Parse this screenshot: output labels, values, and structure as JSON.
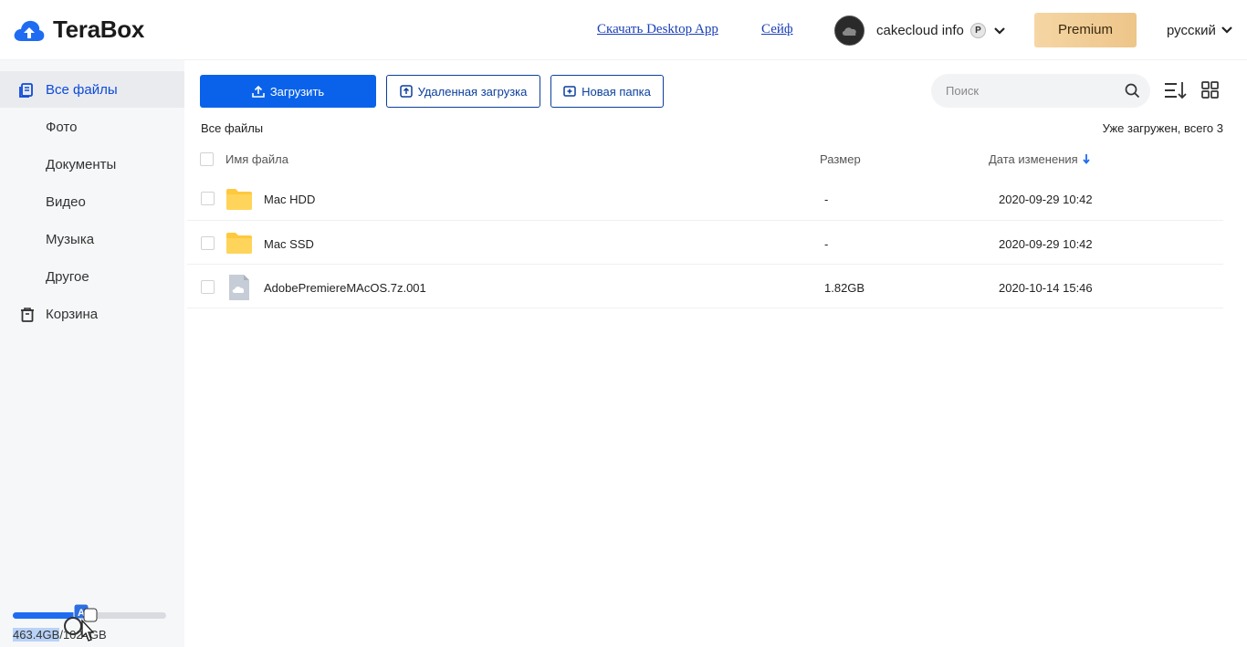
{
  "header": {
    "logo_text": "TeraBox",
    "download_link": "Скачать Desktop App",
    "safe_link": "Сейф",
    "user_name": "cakecloud info",
    "user_badge": "P",
    "premium_label": "Premium",
    "language": "русский"
  },
  "sidebar": {
    "items": [
      {
        "label": "Все файлы",
        "icon": "files-icon"
      },
      {
        "label": "Фото"
      },
      {
        "label": "Документы"
      },
      {
        "label": "Видео"
      },
      {
        "label": "Музыка"
      },
      {
        "label": "Другое"
      },
      {
        "label": "Корзина",
        "icon": "trash-icon"
      }
    ],
    "storage": {
      "used": "463.4GB",
      "rest": "/1024GB",
      "used_fraction": 0.45
    }
  },
  "toolbar": {
    "upload_label": "Загрузить",
    "remote_label": "Удаленная загрузка",
    "new_folder_label": "Новая папка",
    "search_placeholder": "Поиск"
  },
  "content": {
    "breadcrumb": "Все файлы",
    "loaded_status": "Уже загружен, всего 3",
    "columns": {
      "name": "Имя файла",
      "size": "Размер",
      "date": "Дата изменения"
    },
    "files": [
      {
        "name": "Mac HDD",
        "size": "-",
        "date": "2020-09-29 10:42",
        "type": "folder"
      },
      {
        "name": "Mac SSD",
        "size": "-",
        "date": "2020-09-29 10:42",
        "type": "folder"
      },
      {
        "name": "AdobePremiereMAcOS.7z.001",
        "size": "1.82GB",
        "date": "2020-10-14 15:46",
        "type": "file"
      }
    ]
  },
  "colors": {
    "accent": "#0a62ea",
    "active_nav": "#0c4ad8",
    "premium_gold": "#f5d6a4",
    "folder_yellow": "#ffc93d"
  }
}
